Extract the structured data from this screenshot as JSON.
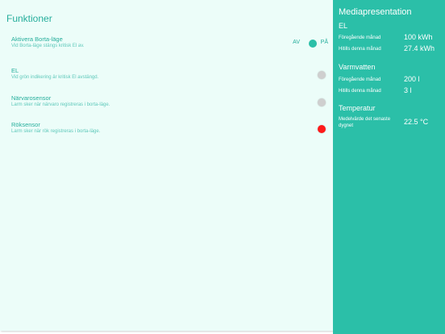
{
  "functions": {
    "title": "Funktioner",
    "away_mode": {
      "title": "Aktivera Borta-läge",
      "description": "Vid Borta-läge stängs kritisk El av.",
      "off_label": "AV",
      "on_label": "PÅ",
      "state": "on"
    },
    "items": [
      {
        "title": "EL",
        "description": "Vid grön indikering är kritisk El avstängd.",
        "indicator_color": "#cfcfcf"
      },
      {
        "title": "Närvarosensor",
        "description": "Larm sker när närvaro registreras i borta-läge.",
        "indicator_color": "#cfcfcf"
      },
      {
        "title": "Röksensor",
        "description": "Larm sker när rök registreras i borta-läge.",
        "indicator_color": "#ff1a1a"
      }
    ]
  },
  "media": {
    "title": "Mediapresentation",
    "el": {
      "title": "EL",
      "prev_label": "Föregående månad",
      "prev_value": "100 kWh",
      "curr_label": "Hitills denna månad",
      "curr_value": "27.4 kWh"
    },
    "water": {
      "title": "Varmvatten",
      "prev_label": "Föregående månad",
      "prev_value": "200 l",
      "curr_label": "Hitills denna månad",
      "curr_value": "3 l"
    },
    "temp": {
      "title": "Temperatur",
      "avg_label": "Medelvärde det senaste dygnet",
      "avg_value": "22.5 °C"
    }
  },
  "colors": {
    "accent": "#2bbfa8",
    "panel_bg": "#ecfdf9",
    "text_teal": "#26ae9c"
  }
}
